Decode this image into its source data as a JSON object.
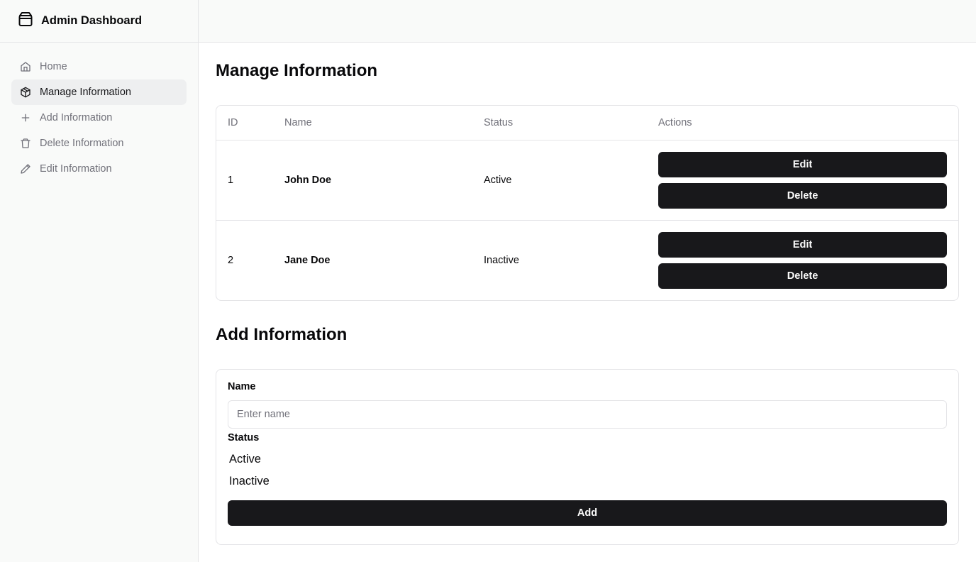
{
  "sidebar": {
    "brand": "Admin Dashboard",
    "items": [
      {
        "label": "Home",
        "icon": "home-icon"
      },
      {
        "label": "Manage Information",
        "icon": "package-icon",
        "active": true
      },
      {
        "label": "Add Information",
        "icon": "plus-icon"
      },
      {
        "label": "Delete Information",
        "icon": "trash-icon"
      },
      {
        "label": "Edit Information",
        "icon": "pencil-icon"
      }
    ]
  },
  "manage": {
    "title": "Manage Information",
    "columns": [
      "ID",
      "Name",
      "Status",
      "Actions"
    ],
    "rows": [
      {
        "id": "1",
        "name": "John Doe",
        "status": "Active",
        "edit": "Edit",
        "delete": "Delete"
      },
      {
        "id": "2",
        "name": "Jane Doe",
        "status": "Inactive",
        "edit": "Edit",
        "delete": "Delete"
      }
    ]
  },
  "add": {
    "title": "Add Information",
    "name_label": "Name",
    "name_placeholder": "Enter name",
    "name_value": "",
    "status_label": "Status",
    "status_options": [
      "Active",
      "Inactive"
    ],
    "submit": "Add"
  },
  "colors": {
    "primary": "#18181b",
    "muted_text": "#71717a",
    "border": "#e4e4e7",
    "sidebar_bg": "#f9faf9",
    "active_item_bg": "#eeeff0"
  }
}
